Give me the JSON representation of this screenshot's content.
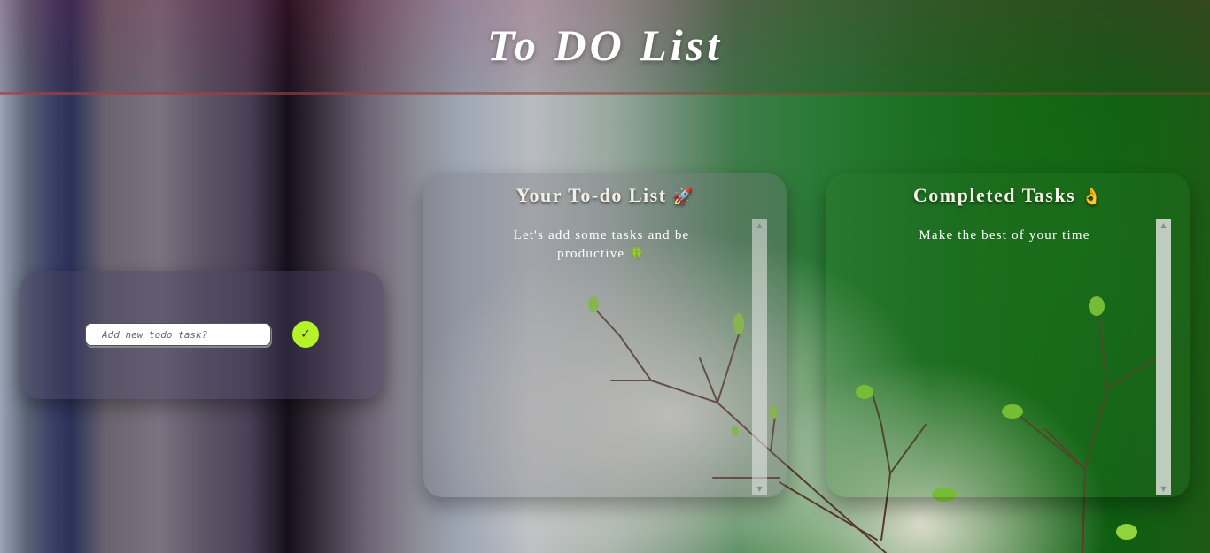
{
  "header": {
    "title": "To DO List"
  },
  "input_card": {
    "placeholder": "Add new todo task?",
    "add_button_label": "✓",
    "add_button_color": "#b5f22a"
  },
  "todo_panel": {
    "heading": "Your To-do List",
    "heading_icon": "🚀",
    "subtext": "Let's add some tasks and be productive",
    "subtext_icon": "🍀"
  },
  "done_panel": {
    "heading": "Completed Tasks",
    "heading_icon": "👌",
    "subtext": "Make the best of your time"
  },
  "icons": {
    "todo_heading": "rocket-icon",
    "todo_subtext": "clover-icon",
    "done_heading": "ok-hand-icon",
    "add": "checkmark-icon",
    "scroll_up": "triangle-up-icon",
    "scroll_down": "triangle-down-icon"
  }
}
